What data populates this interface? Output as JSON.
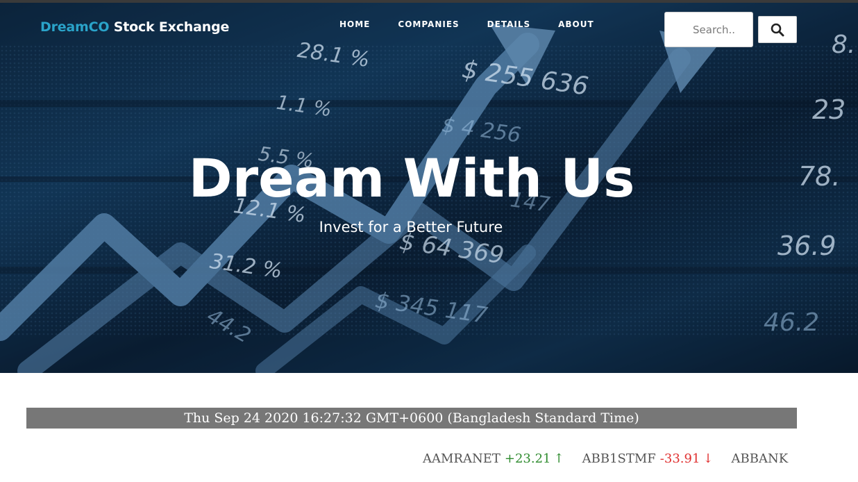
{
  "brand": {
    "accent": "DreamCO",
    "rest": " Stock Exchange"
  },
  "nav": {
    "home": "HOME",
    "companies": "COMPANIES",
    "details": "DETAILS",
    "about": "ABOUT"
  },
  "search": {
    "placeholder": "Search..",
    "button_icon": "search-icon"
  },
  "hero": {
    "title": "Dream With Us",
    "subtitle": "Invest for a Better Future",
    "background_numbers": [
      "28.1 %",
      "$ 255 636",
      "1.1 %",
      "$ 4 256",
      "5.5 %",
      "12.1 %",
      "$ 64 369",
      "31.2 %",
      "$ 345 117",
      "8.",
      "23",
      "78.",
      "36.9",
      "46.2",
      "147",
      "44.2"
    ]
  },
  "clock": {
    "text": "Thu Sep 24 2020 16:27:32 GMT+0600 (Bangladesh Standard Time)"
  },
  "ticker": [
    {
      "symbol": "AAMRANET",
      "change": "+23.21",
      "arrow": "↑",
      "direction": "up"
    },
    {
      "symbol": "ABB1STMF",
      "change": "-33.91",
      "arrow": "↓",
      "direction": "down"
    },
    {
      "symbol": "ABBANK",
      "change": "",
      "arrow": "",
      "direction": ""
    }
  ],
  "colors": {
    "accent": "#2aa3c9",
    "up": "#2e8b2e",
    "down": "#e03030",
    "clock_bar": "#777777"
  }
}
